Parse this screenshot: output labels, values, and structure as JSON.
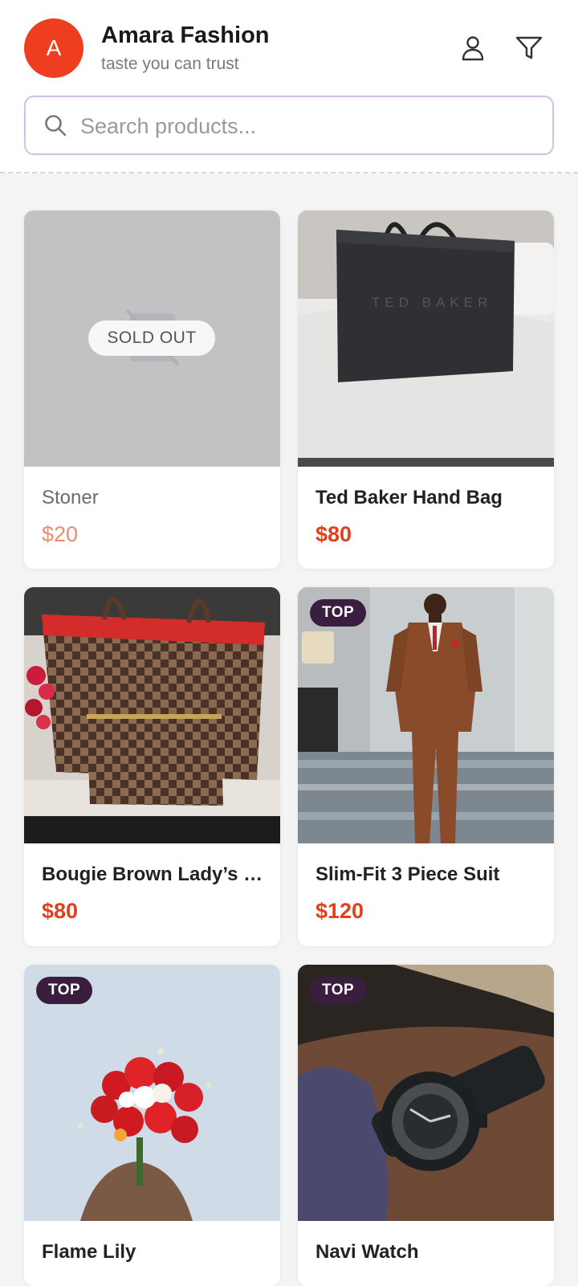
{
  "header": {
    "avatar_letter": "A",
    "store_name": "Amara Fashion",
    "tagline": "taste you can trust",
    "icons": [
      "user-icon",
      "filter-icon"
    ]
  },
  "search": {
    "placeholder": "Search products..."
  },
  "colors": {
    "accent": "#ee3d1f",
    "price": "#e1401d",
    "badge": "#3a1e3f",
    "search_border": "#d6bfe3"
  },
  "products": [
    {
      "name": "Stoner",
      "price": "$20",
      "status": "SOLD OUT"
    },
    {
      "name": "Ted Baker Hand Bag",
      "price": "$80",
      "image_text": "TED BAKER"
    },
    {
      "name": "Bougie Brown Lady’s …",
      "price": "$80"
    },
    {
      "name": "Slim-Fit 3 Piece Suit",
      "price": "$120",
      "badge": "TOP"
    },
    {
      "name": "Flame Lily",
      "price": "",
      "badge": "TOP"
    },
    {
      "name": "Navi Watch",
      "price": "",
      "badge": "TOP"
    }
  ]
}
